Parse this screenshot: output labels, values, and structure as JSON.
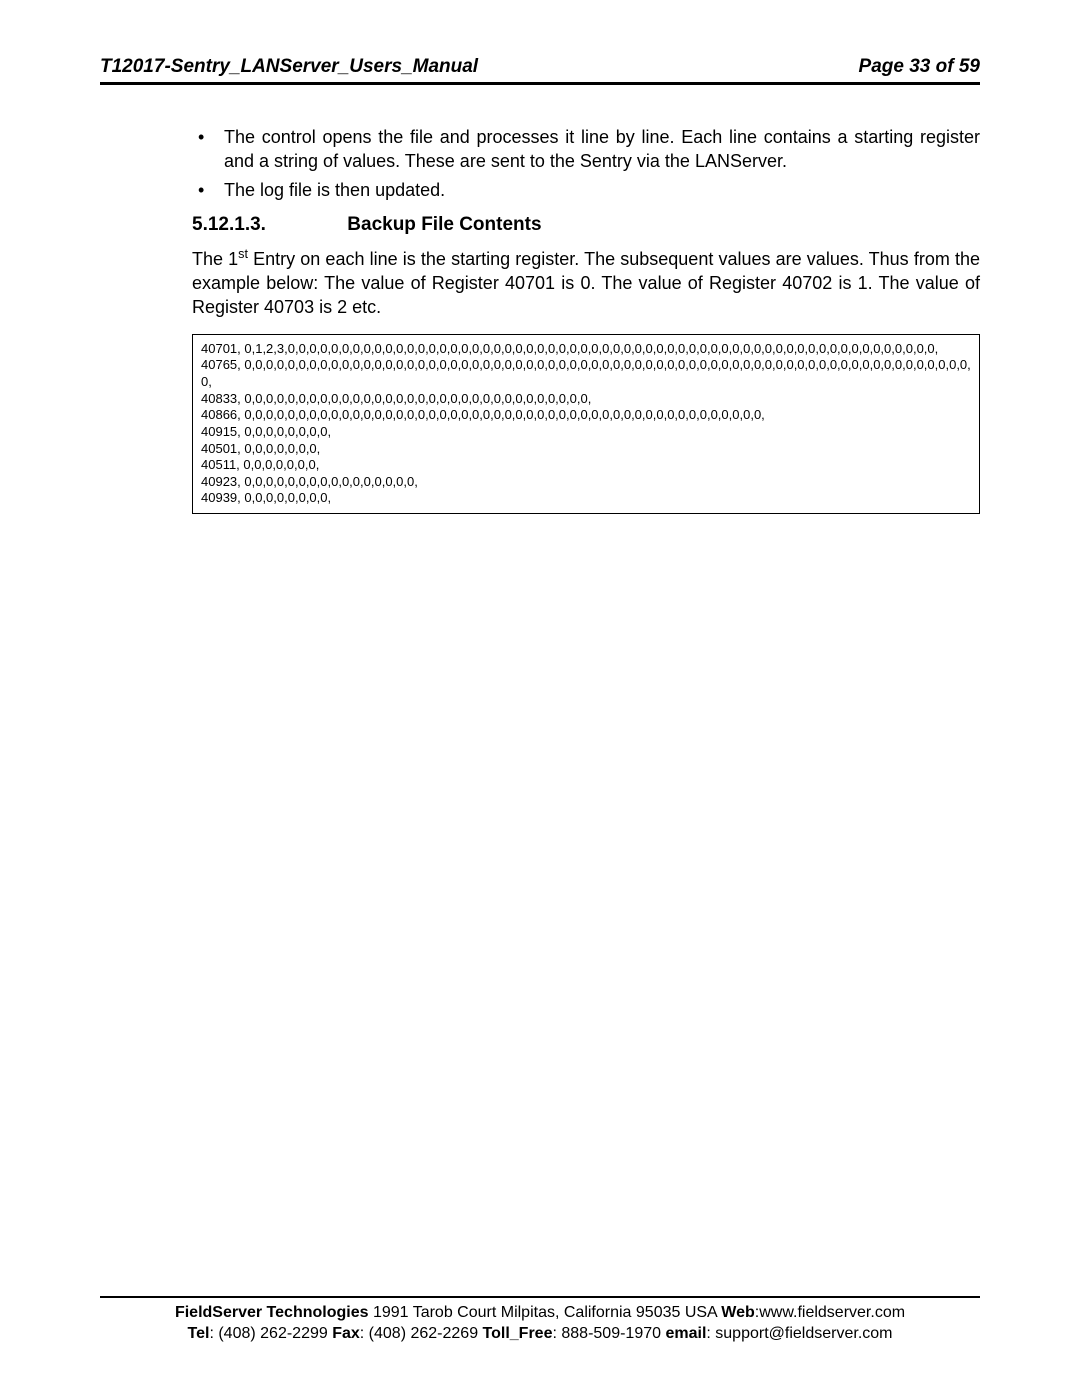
{
  "header": {
    "title": "T12017-Sentry_LANServer_Users_Manual",
    "page_label": "Page 33 of 59"
  },
  "bullets": [
    "The control opens the file and processes it line by line. Each line contains a starting register and a string of values.  These are sent to the Sentry via the LANServer.",
    "The log file is then updated."
  ],
  "section": {
    "number": "5.12.1.3.",
    "title": "Backup File Contents"
  },
  "paragraph": {
    "prefix": "The 1",
    "sup": "st",
    "rest": " Entry on each line is the starting register. The subsequent values are values. Thus from the example below: The value of Register 40701 is 0. The value of Register 40702 is 1. The value of Register 40703 is 2 etc."
  },
  "code_lines": [
    "40701, 0,1,2,3,0,0,0,0,0,0,0,0,0,0,0,0,0,0,0,0,0,0,0,0,0,0,0,0,0,0,0,0,0,0,0,0,0,0,0,0,0,0,0,0,0,0,0,0,0,0,0,0,0,0,0,0,0,0,0,0,0,0,0,0,",
    "40765, 0,0,0,0,0,0,0,0,0,0,0,0,0,0,0,0,0,0,0,0,0,0,0,0,0,0,0,0,0,0,0,0,0,0,0,0,0,0,0,0,0,0,0,0,0,0,0,0,0,0,0,0,0,0,0,0,0,0,0,0,0,0,0,0,0,0,0,0,",
    "40833, 0,0,0,0,0,0,0,0,0,0,0,0,0,0,0,0,0,0,0,0,0,0,0,0,0,0,0,0,0,0,0,0,",
    "40866, 0,0,0,0,0,0,0,0,0,0,0,0,0,0,0,0,0,0,0,0,0,0,0,0,0,0,0,0,0,0,0,0,0,0,0,0,0,0,0,0,0,0,0,0,0,0,0,0,",
    "40915, 0,0,0,0,0,0,0,0,",
    "40501, 0,0,0,0,0,0,0,",
    "40511, 0,0,0,0,0,0,0,",
    "40923, 0,0,0,0,0,0,0,0,0,0,0,0,0,0,0,0,",
    "40939, 0,0,0,0,0,0,0,0,"
  ],
  "footer": {
    "company_bold": "FieldServer Technologies",
    "address": " 1991 Tarob Court Milpitas, California 95035 USA  ",
    "web_label": "Web",
    "web_value": ":www.fieldserver.com",
    "tel_label": "Tel",
    "tel_value": ": (408) 262-2299   ",
    "fax_label": "Fax",
    "fax_value": ": (408) 262-2269   ",
    "toll_label": "Toll_Free",
    "toll_value": ": 888-509-1970   ",
    "email_label": "email",
    "email_value": ": support@fieldserver.com"
  }
}
